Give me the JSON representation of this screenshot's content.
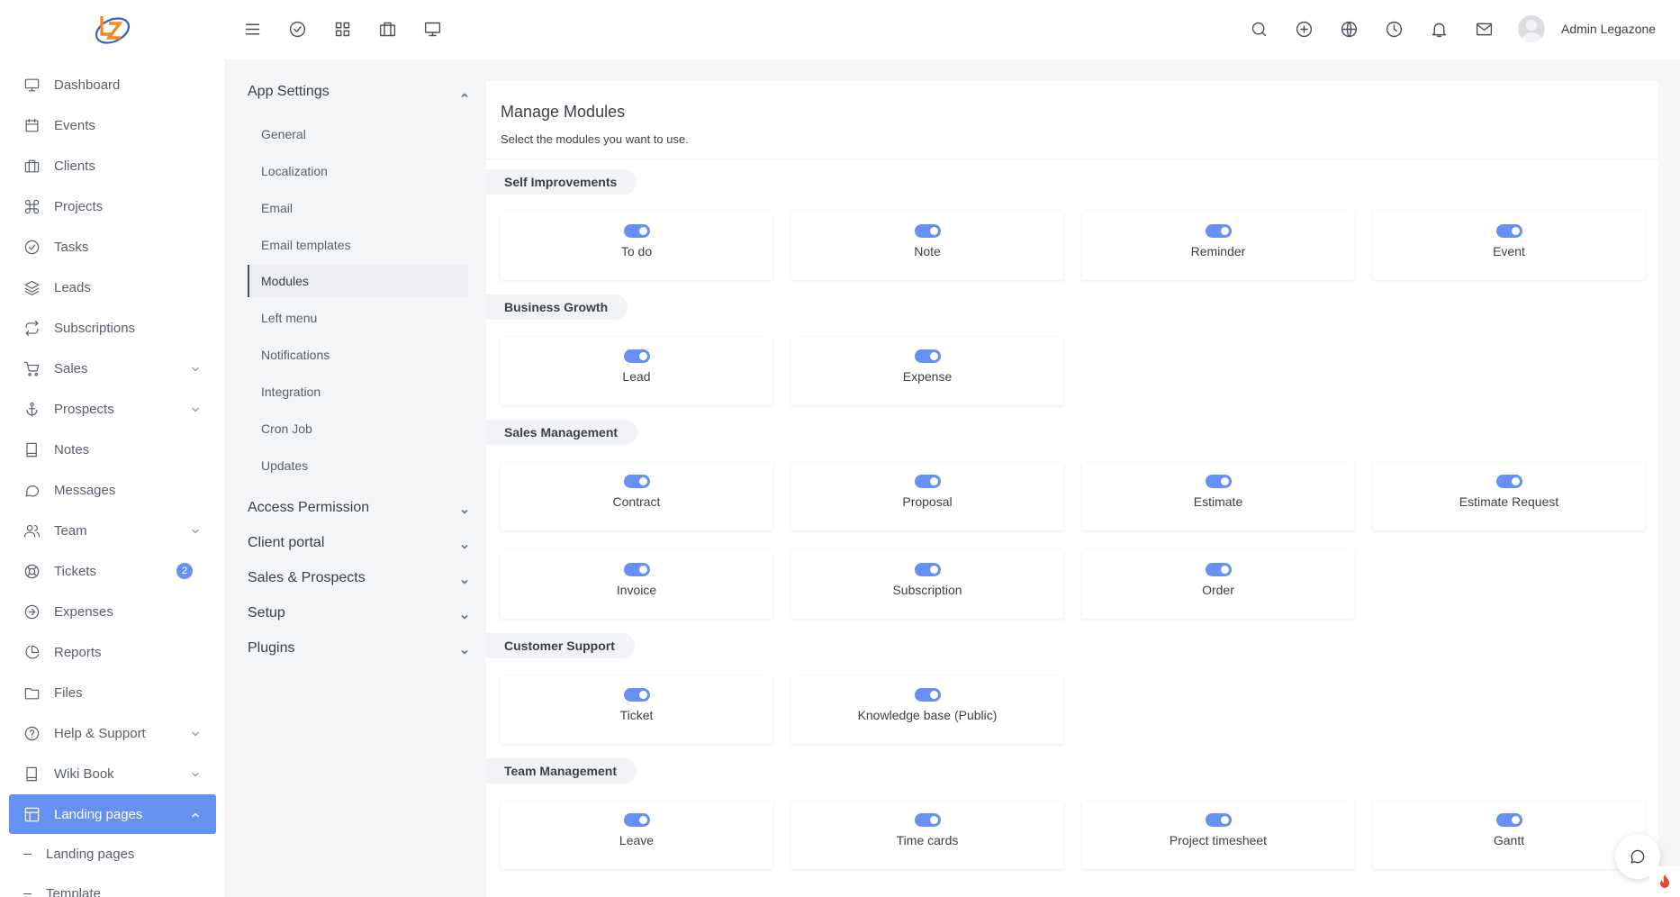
{
  "header": {
    "username": "Admin Legazone",
    "left_icons": [
      "menu-icon",
      "check-circle-icon",
      "grid-icon",
      "briefcase-icon",
      "monitor-icon"
    ],
    "right_icons": [
      "search-icon",
      "plus-circle-icon",
      "globe-icon",
      "clock-icon",
      "bell-icon",
      "mail-icon"
    ]
  },
  "sidebar": {
    "items": [
      {
        "label": "Dashboard",
        "icon": "monitor-icon"
      },
      {
        "label": "Events",
        "icon": "calendar-icon"
      },
      {
        "label": "Clients",
        "icon": "briefcase-icon"
      },
      {
        "label": "Projects",
        "icon": "command-icon"
      },
      {
        "label": "Tasks",
        "icon": "check-circle-icon"
      },
      {
        "label": "Leads",
        "icon": "layers-icon"
      },
      {
        "label": "Subscriptions",
        "icon": "repeat-icon"
      },
      {
        "label": "Sales",
        "icon": "cart-icon"
      },
      {
        "label": "Prospects",
        "icon": "anchor-icon"
      },
      {
        "label": "Notes",
        "icon": "book-icon"
      },
      {
        "label": "Messages",
        "icon": "message-icon"
      },
      {
        "label": "Team",
        "icon": "users-icon"
      },
      {
        "label": "Tickets",
        "icon": "lifebuoy-icon",
        "badge": "2"
      },
      {
        "label": "Expenses",
        "icon": "arrow-circle-icon"
      },
      {
        "label": "Reports",
        "icon": "pie-chart-icon"
      },
      {
        "label": "Files",
        "icon": "folder-icon"
      },
      {
        "label": "Help & Support",
        "icon": "help-icon"
      },
      {
        "label": "Wiki Book",
        "icon": "book-icon"
      },
      {
        "label": "Landing pages",
        "icon": "layout-icon"
      }
    ],
    "sub_items": [
      "Landing pages",
      "Template"
    ]
  },
  "settings": {
    "app_settings": "App Settings",
    "items": [
      "General",
      "Localization",
      "Email",
      "Email templates",
      "Modules",
      "Left menu",
      "Notifications",
      "Integration",
      "Cron Job",
      "Updates"
    ],
    "groups": [
      "Access Permission",
      "Client portal",
      "Sales & Prospects",
      "Setup",
      "Plugins"
    ]
  },
  "main": {
    "title": "Manage Modules",
    "subtitle": "Select the modules you want to use.",
    "sections": [
      {
        "label": "Self Improvements",
        "modules": [
          "To do",
          "Note",
          "Reminder",
          "Event"
        ]
      },
      {
        "label": "Business Growth",
        "modules": [
          "Lead",
          "Expense"
        ]
      },
      {
        "label": "Sales Management",
        "modules": [
          "Contract",
          "Proposal",
          "Estimate",
          "Estimate Request",
          "Invoice",
          "Subscription",
          "Order"
        ]
      },
      {
        "label": "Customer Support",
        "modules": [
          "Ticket",
          "Knowledge base (Public)"
        ]
      },
      {
        "label": "Team Management",
        "modules": [
          "Leave",
          "Time cards",
          "Project timesheet",
          "Gantt"
        ]
      }
    ]
  },
  "colors": {
    "accent": "#6690f4",
    "logo_orange": "#f2891b",
    "logo_blue": "#2c66c9"
  }
}
